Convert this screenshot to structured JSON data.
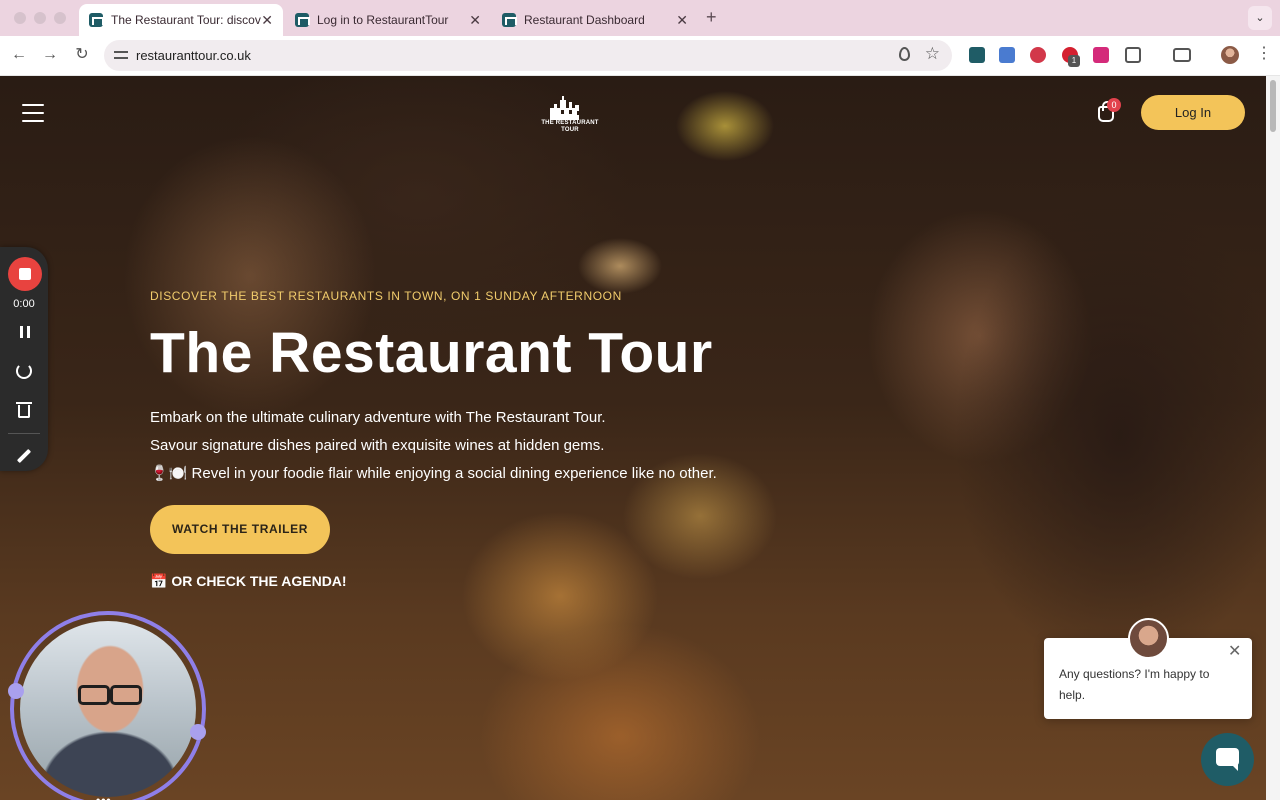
{
  "browser": {
    "tabs": [
      {
        "title": "The Restaurant Tour: discove",
        "active": true
      },
      {
        "title": "Log in to RestaurantTour",
        "active": false
      },
      {
        "title": "Restaurant Dashboard",
        "active": false
      }
    ],
    "tab_close": "✕",
    "new_tab": "+",
    "tab_menu": "⌄",
    "url": "restauranttour.co.uk",
    "extension_badge": "1",
    "nav_icons": {
      "back": "←",
      "forward": "→",
      "reload": "↻",
      "star": "☆",
      "menu": "⋮"
    }
  },
  "header": {
    "logo_text": "THE RESTAURANT TOUR",
    "cart_count": "0",
    "login_label": "Log In"
  },
  "hero": {
    "eyebrow": "DISCOVER THE BEST RESTAURANTS IN TOWN, ON 1 SUNDAY AFTERNOON",
    "title": "The Restaurant Tour",
    "description_lines": [
      "Embark on the ultimate culinary adventure with The Restaurant Tour.",
      "Savour signature dishes paired with exquisite wines at hidden gems.",
      "🍷🍽️ Revel in your foodie flair while enjoying a social dining experience like no other."
    ],
    "trailer_button": "WATCH THE TRAILER",
    "agenda_link": "📅 OR CHECK THE AGENDA!"
  },
  "recorder": {
    "time": "0:00"
  },
  "webcam": {
    "more": "•••"
  },
  "chat": {
    "message": "Any questions? I'm happy to help.",
    "close": "✕"
  },
  "colors": {
    "accent": "#f3c459",
    "eyebrow": "#f1cc6c",
    "chat_launcher": "#1f5c66",
    "record": "#e8433f",
    "webcam_ring": "#8f7fe8"
  }
}
